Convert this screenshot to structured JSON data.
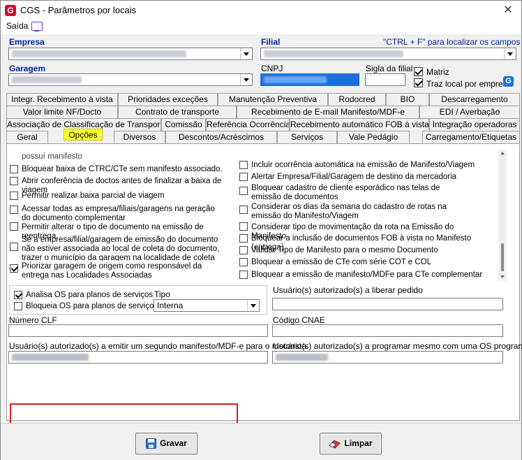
{
  "window": {
    "title": "CGS - Parâmetros por locais",
    "close": "✕"
  },
  "menu": {
    "saida": "Saída"
  },
  "header": {
    "empresa_label": "Empresa",
    "filial_label": "Filial",
    "hint": "\"CTRL + F\" para localizar os campos",
    "garagem_label": "Garagem",
    "cnpj_label": "CNPJ",
    "sigla_label": "Sigla da filial",
    "matriz_label": "Matriz",
    "matriz_checked": true,
    "traz_local_label": "Traz local por empresa",
    "traz_local_checked": true
  },
  "tabs": {
    "row1": [
      "Integr. Recebimento à vista",
      "Prioridades exceções",
      "Manutenção Preventiva",
      "Rodocred",
      "BIO",
      "Descarregamento"
    ],
    "row2": [
      "Valor limite NF/Docto",
      "Contrato de transporte",
      "Recebimento de E-mail Manifesto/MDF-e",
      "EDI / Averbação"
    ],
    "row3": [
      "Associação de Classificação de Transporte",
      "Comissão",
      "Referência Ocorrência",
      "Recebimento automático FOB à vista",
      "Integração operadoras"
    ],
    "row4": [
      "Geral",
      "Opções",
      "Diversos",
      "Descontos/Acréscimos",
      "Serviços",
      "Vale Pedágio",
      "Carregamento/Etiquetas"
    ],
    "active": "Opções"
  },
  "options_left": [
    {
      "label": "possuí manifesto",
      "checked": false
    },
    {
      "label": "Bloquear baixa de CTRC/CTe sem manifesto associado.",
      "checked": false
    },
    {
      "label": "Abrir conferência de doctos antes de finalizar a baixa de viagem",
      "checked": false
    },
    {
      "label": "Permitir realizar baixa parcial de viagem",
      "checked": false
    },
    {
      "label": "Acessar todas as empresa/filiais/garagens na geração do documento complementar",
      "checked": false
    },
    {
      "label": "Permitir alterar o tipo de documento na emissão de reentrega",
      "checked": false
    },
    {
      "label": "Se a empresa/filial/garagem de emissão do documento não estiver associada ao local de coleta do documento, trazer o município da garagem na localidade de coleta",
      "checked": false
    },
    {
      "label": "Priorizar garagem de origem como responsável da entrega nas Localidades Associadas",
      "checked": true
    }
  ],
  "options_right": [
    {
      "label": "Incluir ocorrência automática na emissão de Manifesto/Viagem",
      "checked": false
    },
    {
      "label": "Alertar Empresa/Filial/Garagem de destino da mercadoria",
      "checked": false
    },
    {
      "label": "Bloquear cadastro de cliente esporádico nas telas de emissão de documentos",
      "checked": false
    },
    {
      "label": "Considerar os dias da semana do cadastro de rotas na emissão do Manifesto/Viagem",
      "checked": false
    },
    {
      "label": "Considerar tipo de movimentação da rota na Emissão do Manifesto",
      "checked": false
    },
    {
      "label": "Bloquear a inclusão de documentos FOB à vista no Manifesto (entrega)",
      "checked": false
    },
    {
      "label": "Validar Tipo de Manifesto para o mesmo Documento",
      "checked": false
    },
    {
      "label": "Bloquear a emissão de CTe com série COT e COL",
      "checked": false
    },
    {
      "label": "Bloquear a emissão de manifesto/MDFe para CTe complementar",
      "checked": false
    }
  ],
  "os": {
    "analisa_label": "Analisa OS para planos de serviços",
    "analisa_checked": true,
    "bloqueia_label": "Bloqueia OS para planos de serviços",
    "bloqueia_checked": false,
    "tipo_label": "Tipo",
    "tipo_value": "Interna"
  },
  "fields": {
    "usuario_liberar_label": "Usuário(s) autorizado(s) a liberar pedido",
    "numero_clf_label": "Número CLF",
    "codigo_cnae_label": "Código CNAE",
    "usuario_segundo_label": "Usuário(s) autorizado(s) a emitir um segundo manifesto/MDF-e para o motorista",
    "usuario_programar_label": "Usuário(s) autorizado(s) a programar mesmo com uma OS programada"
  },
  "buttons": {
    "gravar": "Gravar",
    "limpar": "Limpar"
  },
  "colors": {
    "label_blue": "#00249c",
    "active_tab": "#ffff33",
    "highlight_border": "#d62020"
  }
}
